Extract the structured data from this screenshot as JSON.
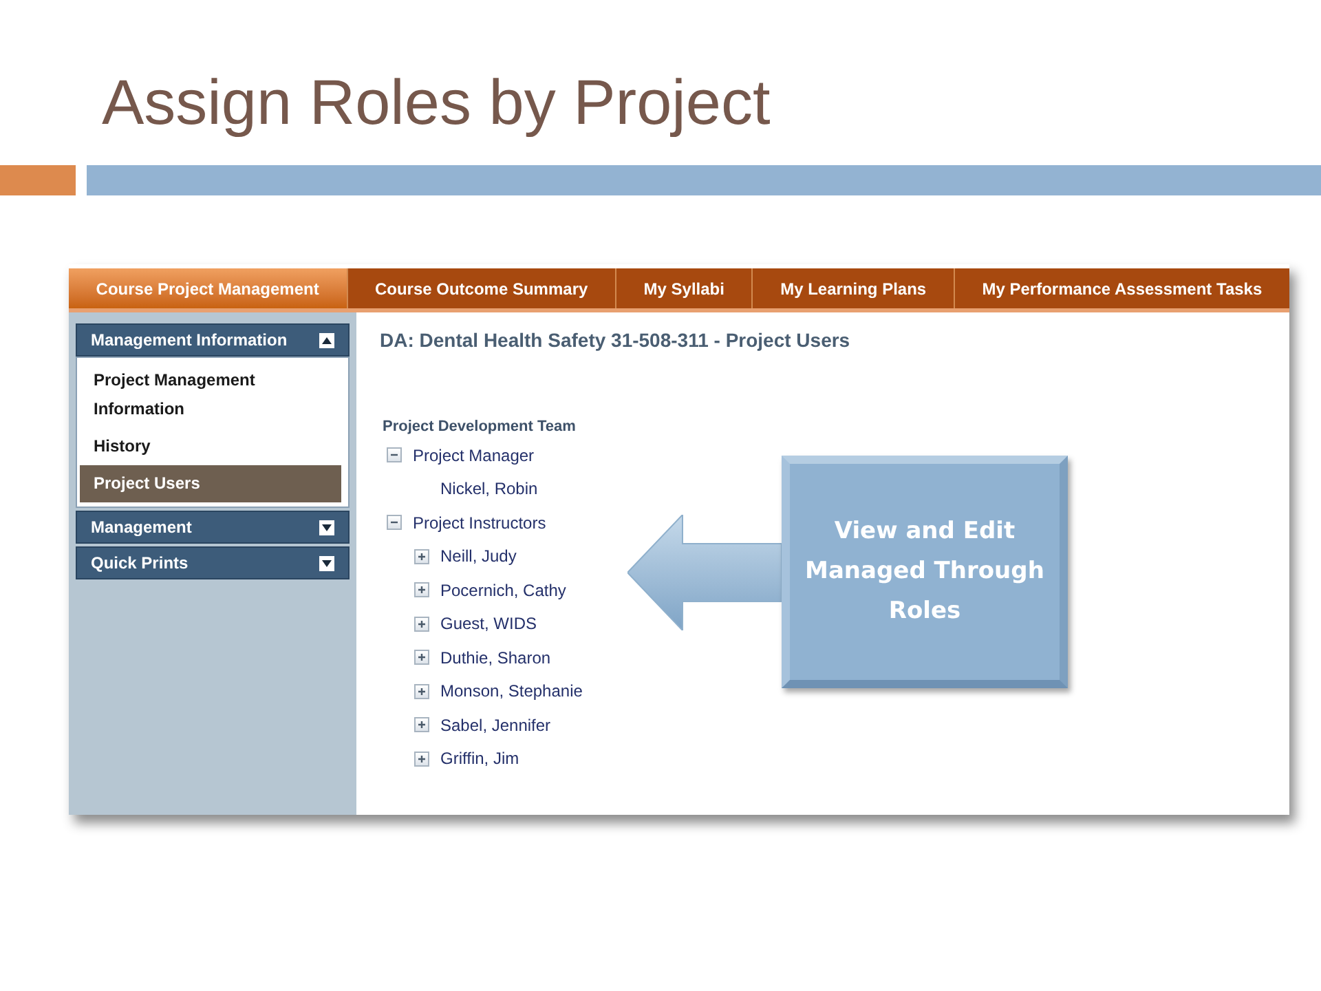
{
  "slide": {
    "title": "Assign Roles by Project"
  },
  "tabs": [
    {
      "label": "Course Project Management",
      "selected": true
    },
    {
      "label": "Course Outcome Summary",
      "selected": false
    },
    {
      "label": "My Syllabi",
      "selected": false
    },
    {
      "label": "My Learning Plans",
      "selected": false
    },
    {
      "label": "My Performance Assessment Tasks",
      "selected": false
    }
  ],
  "sidebar": {
    "sections": [
      {
        "label": "Management Information",
        "expanded": true,
        "items": [
          {
            "label": "Project Management Information",
            "selected": false
          },
          {
            "label": "History",
            "selected": false
          },
          {
            "label": "Project Users",
            "selected": true
          }
        ]
      },
      {
        "label": "Management",
        "expanded": false
      },
      {
        "label": "Quick Prints",
        "expanded": false
      }
    ]
  },
  "content": {
    "heading": "DA: Dental Health Safety 31-508-311 - Project Users",
    "team": {
      "label": "Project Development Team",
      "items": [
        {
          "label": "Project Manager",
          "expanded": true,
          "children": [
            {
              "label": "Nickel, Robin"
            }
          ]
        },
        {
          "label": "Project Instructors",
          "expanded": true,
          "children": [
            {
              "label": "Neill, Judy",
              "expanded": false
            },
            {
              "label": "Pocernich, Cathy",
              "expanded": false
            },
            {
              "label": "Guest, WIDS",
              "expanded": false
            },
            {
              "label": "Duthie, Sharon",
              "expanded": false
            },
            {
              "label": "Monson, Stephanie",
              "expanded": false
            },
            {
              "label": "Sabel, Jennifer",
              "expanded": false
            },
            {
              "label": "Griffin, Jim",
              "expanded": false
            }
          ]
        }
      ]
    }
  },
  "callout": {
    "text": "View and Edit Managed Through Roles"
  }
}
